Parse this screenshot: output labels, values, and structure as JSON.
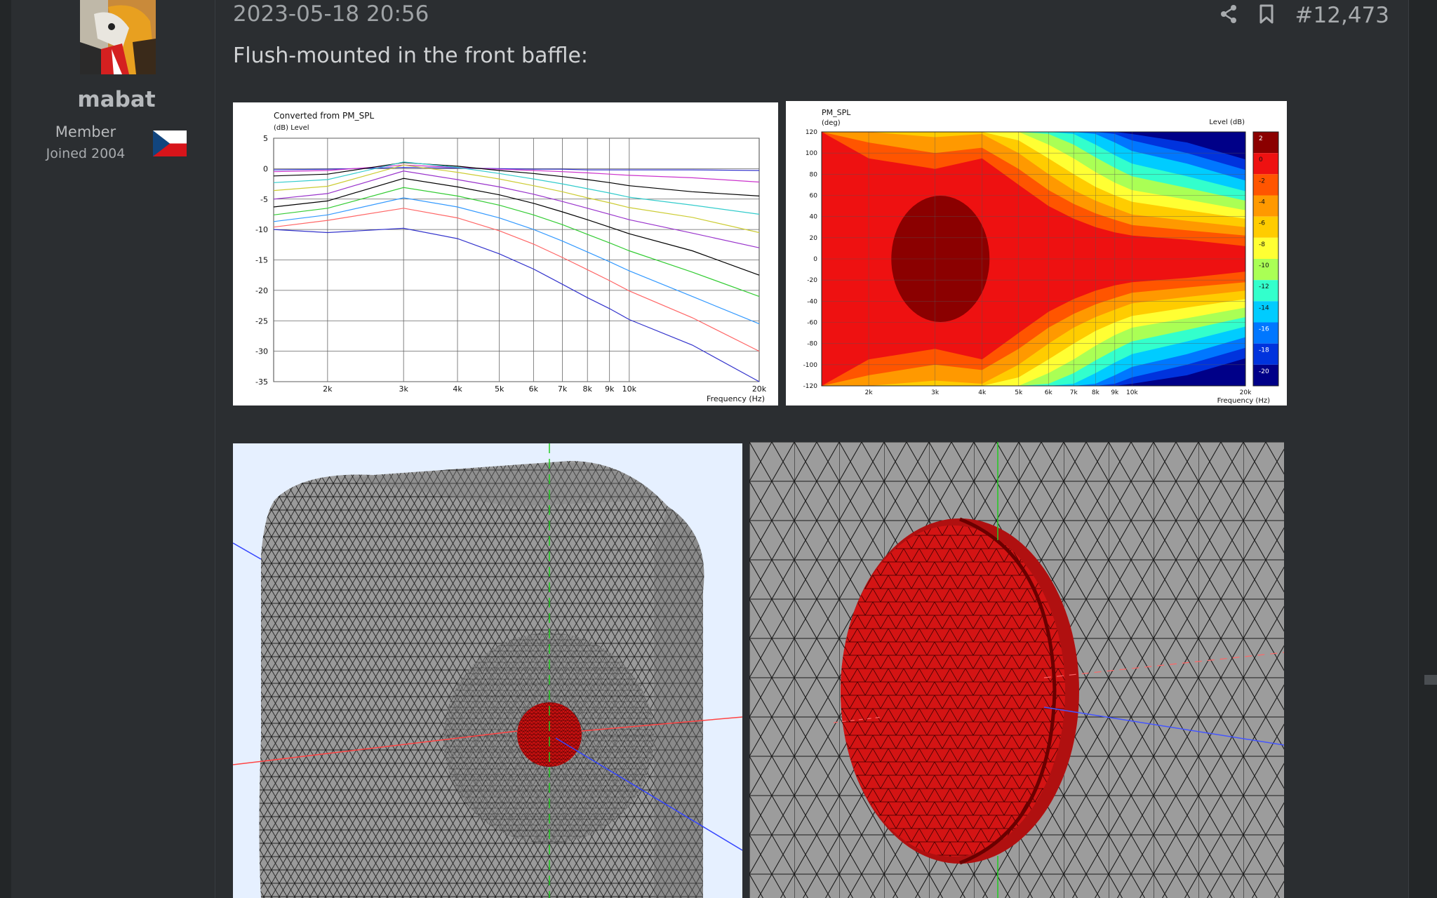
{
  "user": {
    "name": "mabat",
    "role": "Member",
    "joined": "Joined 2004"
  },
  "post": {
    "date": "2023-05-18 20:56",
    "number": "#12,473",
    "message": "Flush-mounted in the front baffle:"
  },
  "icons": {
    "share": "share-icon",
    "bookmark": "bookmark-icon"
  },
  "chart_data": [
    {
      "type": "line",
      "title": "Converted from PM_SPL",
      "subtitle": "(dB)  Level",
      "xlabel": "Frequency  (Hz)",
      "xscale": "log",
      "xlim": [
        1500,
        20000
      ],
      "ylim": [
        -35,
        5
      ],
      "x_ticks": [
        "2k",
        "3k",
        "4k",
        "5k",
        "6k",
        "7k",
        "8k",
        "9k",
        "10k",
        "20k"
      ],
      "y_ticks": [
        "5",
        "0",
        "-5",
        "-10",
        "-15",
        "-20",
        "-25",
        "-30",
        "-35"
      ],
      "x": [
        1500,
        2000,
        3000,
        4000,
        5000,
        6000,
        7000,
        8000,
        9000,
        10000,
        14000,
        20000
      ],
      "series": [
        {
          "color": "#3333cc",
          "values": [
            -0.2,
            -0.1,
            0.2,
            0.1,
            0.0,
            -0.1,
            -0.1,
            -0.2,
            -0.2,
            -0.2,
            -0.2,
            -0.3
          ]
        },
        {
          "color": "#cc33cc",
          "values": [
            -0.5,
            -0.3,
            0.6,
            0.2,
            -0.1,
            -0.3,
            -0.5,
            -0.7,
            -0.9,
            -1.1,
            -1.5,
            -2.2
          ]
        },
        {
          "color": "#000000",
          "values": [
            -1.2,
            -0.9,
            1.0,
            0.4,
            -0.3,
            -0.8,
            -1.3,
            -1.8,
            -2.3,
            -2.8,
            -3.8,
            -4.5
          ]
        },
        {
          "color": "#33cccc",
          "values": [
            -2.3,
            -1.8,
            1.1,
            0.2,
            -0.8,
            -1.7,
            -2.5,
            -3.3,
            -4.0,
            -4.7,
            -6.0,
            -7.5
          ]
        },
        {
          "color": "#cccc33",
          "values": [
            -3.6,
            -2.9,
            0.6,
            -0.6,
            -1.7,
            -2.8,
            -3.8,
            -4.8,
            -5.6,
            -6.4,
            -8.0,
            -10.5
          ]
        },
        {
          "color": "#9933cc",
          "values": [
            -5.0,
            -4.1,
            -0.4,
            -1.8,
            -3.0,
            -4.2,
            -5.4,
            -6.5,
            -7.5,
            -8.4,
            -10.6,
            -13.0
          ]
        },
        {
          "color": "#000000",
          "values": [
            -6.3,
            -5.3,
            -1.6,
            -3.0,
            -4.3,
            -5.7,
            -7.1,
            -8.4,
            -9.6,
            -10.7,
            -13.5,
            -17.5
          ]
        },
        {
          "color": "#33cc33",
          "values": [
            -7.6,
            -6.5,
            -3.1,
            -4.5,
            -6.0,
            -7.6,
            -9.2,
            -10.8,
            -12.2,
            -13.5,
            -17.0,
            -21.0
          ]
        },
        {
          "color": "#3399ff",
          "values": [
            -8.7,
            -7.6,
            -4.8,
            -6.3,
            -8.1,
            -10.0,
            -11.9,
            -13.7,
            -15.3,
            -16.8,
            -21.0,
            -25.5
          ]
        },
        {
          "color": "#ff6666",
          "values": [
            -9.6,
            -8.5,
            -6.5,
            -8.1,
            -10.2,
            -12.4,
            -14.6,
            -16.6,
            -18.4,
            -20.1,
            -24.5,
            -30.0
          ]
        },
        {
          "color": "#3333cc",
          "values": [
            -10.0,
            -10.5,
            -9.8,
            -11.5,
            -14.0,
            -16.5,
            -19.0,
            -21.2,
            -23.0,
            -24.8,
            -29.0,
            -35.0
          ]
        }
      ]
    },
    {
      "type": "heatmap",
      "title": "PM_SPL",
      "subtitle": "(deg)",
      "legend_title": "Level  (dB)",
      "xlabel": "Frequency  (Hz)",
      "xscale": "log",
      "xlim": [
        1500,
        20000
      ],
      "ylim": [
        -120,
        120
      ],
      "x_ticks": [
        "2k",
        "3k",
        "4k",
        "5k",
        "6k",
        "7k",
        "8k",
        "9k",
        "10k",
        "20k"
      ],
      "y_ticks": [
        "120",
        "100",
        "80",
        "60",
        "40",
        "20",
        "0",
        "-20",
        "-40",
        "-60",
        "-80",
        "-100",
        "-120"
      ],
      "legend_levels": [
        "2",
        "0",
        "-2",
        "-4",
        "-6",
        "-8",
        "-10",
        "-12",
        "-14",
        "-16",
        "-18",
        "-20"
      ],
      "legend_colors": [
        "#8b0000",
        "#ee1111",
        "#ff5500",
        "#ff9900",
        "#ffcc00",
        "#ffff33",
        "#aaff55",
        "#33ffcc",
        "#00ccff",
        "#0077ff",
        "#0033dd",
        "#000088"
      ],
      "x": [
        1500,
        2000,
        3000,
        4000,
        5000,
        6000,
        7000,
        8000,
        9000,
        10000,
        14000,
        20000
      ],
      "contours": [
        {
          "level": 0,
          "angle": [
            120,
            95,
            85,
            95,
            70,
            50,
            38,
            30,
            25,
            22,
            18,
            12
          ]
        },
        {
          "level": -2,
          "angle": [
            120,
            110,
            100,
            105,
            85,
            65,
            52,
            43,
            37,
            32,
            27,
            22
          ]
        },
        {
          "level": -4,
          "angle": [
            120,
            120,
            115,
            118,
            100,
            80,
            65,
            55,
            48,
            42,
            36,
            30
          ]
        },
        {
          "level": -6,
          "angle": [
            120,
            120,
            120,
            120,
            112,
            95,
            80,
            68,
            60,
            54,
            46,
            38
          ]
        },
        {
          "level": -8,
          "angle": [
            120,
            120,
            120,
            120,
            120,
            108,
            95,
            82,
            72,
            65,
            56,
            46
          ]
        },
        {
          "level": -10,
          "angle": [
            120,
            120,
            120,
            120,
            120,
            118,
            108,
            96,
            86,
            78,
            67,
            55
          ]
        },
        {
          "level": -12,
          "angle": [
            120,
            120,
            120,
            120,
            120,
            120,
            118,
            108,
            98,
            90,
            78,
            64
          ]
        },
        {
          "level": -14,
          "angle": [
            120,
            120,
            120,
            120,
            120,
            120,
            120,
            118,
            110,
            102,
            90,
            74
          ]
        },
        {
          "level": -16,
          "angle": [
            120,
            120,
            120,
            120,
            120,
            120,
            120,
            120,
            118,
            112,
            100,
            84
          ]
        },
        {
          "level": -18,
          "angle": [
            120,
            120,
            120,
            120,
            120,
            120,
            120,
            120,
            120,
            118,
            110,
            94
          ]
        }
      ]
    }
  ]
}
